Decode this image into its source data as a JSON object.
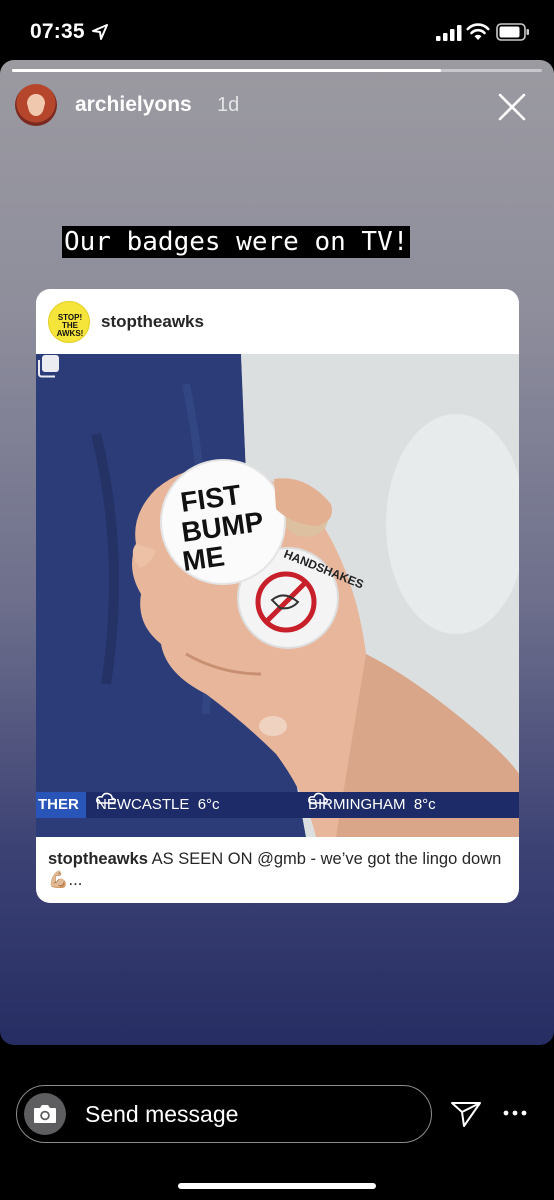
{
  "status_bar": {
    "time": "07:35",
    "location_icon": "location-arrow-icon",
    "signal_icon": "cellular-signal-icon",
    "wifi_icon": "wifi-icon",
    "battery_icon": "battery-icon"
  },
  "story": {
    "progress": 0.81,
    "username": "archielyons",
    "time_ago": "1d",
    "close_icon": "close-icon",
    "caption": "Our badges were on TV!"
  },
  "shared_post": {
    "username": "stoptheawks",
    "avatar_text": "STOP! THE AWKS!",
    "image_badges": [
      "FIST",
      "BUMP",
      "ME"
    ],
    "second_badge_text": "HANDSHAKES",
    "ticker": {
      "head": "THER",
      "items": [
        {
          "city": "NEWCASTLE",
          "temp": "6°c"
        },
        {
          "city": "BIRMINGHAM",
          "temp": "8°c"
        }
      ]
    },
    "caption_user": "stoptheawks",
    "caption_text": "AS SEEN ON @gmb - we’ve got the lingo down 💪🏼..."
  },
  "bottom_bar": {
    "camera_icon": "camera-icon",
    "message_placeholder": "Send message",
    "send_icon": "send-icon",
    "more_icon": "more-icon"
  },
  "colors": {
    "story_bg_top": "#9b9aa1",
    "story_bg_bottom": "#262d62",
    "ticker_bg": "#1d2c68",
    "badge_avatar": "#f5e43a"
  }
}
